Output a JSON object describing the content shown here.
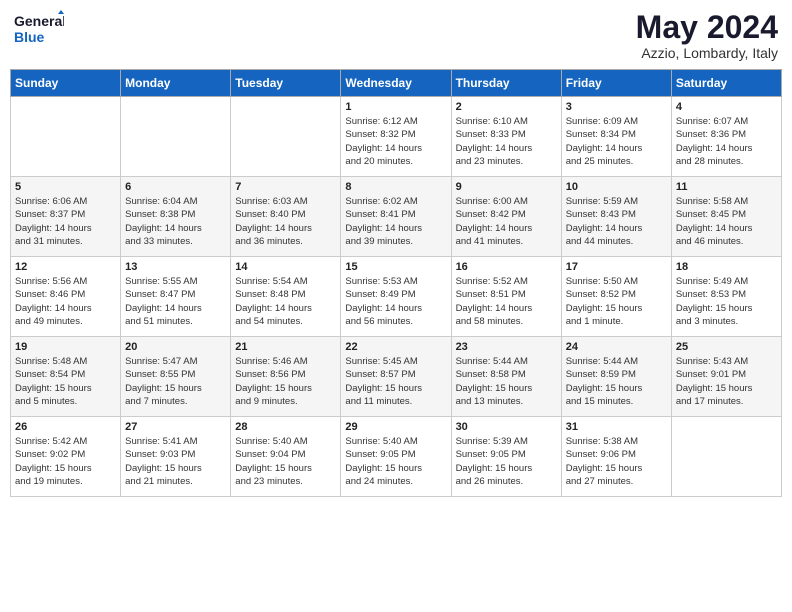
{
  "logo": {
    "line1": "General",
    "line2": "Blue"
  },
  "title": "May 2024",
  "location": "Azzio, Lombardy, Italy",
  "days_of_week": [
    "Sunday",
    "Monday",
    "Tuesday",
    "Wednesday",
    "Thursday",
    "Friday",
    "Saturday"
  ],
  "weeks": [
    [
      {
        "day": "",
        "info": ""
      },
      {
        "day": "",
        "info": ""
      },
      {
        "day": "",
        "info": ""
      },
      {
        "day": "1",
        "info": "Sunrise: 6:12 AM\nSunset: 8:32 PM\nDaylight: 14 hours\nand 20 minutes."
      },
      {
        "day": "2",
        "info": "Sunrise: 6:10 AM\nSunset: 8:33 PM\nDaylight: 14 hours\nand 23 minutes."
      },
      {
        "day": "3",
        "info": "Sunrise: 6:09 AM\nSunset: 8:34 PM\nDaylight: 14 hours\nand 25 minutes."
      },
      {
        "day": "4",
        "info": "Sunrise: 6:07 AM\nSunset: 8:36 PM\nDaylight: 14 hours\nand 28 minutes."
      }
    ],
    [
      {
        "day": "5",
        "info": "Sunrise: 6:06 AM\nSunset: 8:37 PM\nDaylight: 14 hours\nand 31 minutes."
      },
      {
        "day": "6",
        "info": "Sunrise: 6:04 AM\nSunset: 8:38 PM\nDaylight: 14 hours\nand 33 minutes."
      },
      {
        "day": "7",
        "info": "Sunrise: 6:03 AM\nSunset: 8:40 PM\nDaylight: 14 hours\nand 36 minutes."
      },
      {
        "day": "8",
        "info": "Sunrise: 6:02 AM\nSunset: 8:41 PM\nDaylight: 14 hours\nand 39 minutes."
      },
      {
        "day": "9",
        "info": "Sunrise: 6:00 AM\nSunset: 8:42 PM\nDaylight: 14 hours\nand 41 minutes."
      },
      {
        "day": "10",
        "info": "Sunrise: 5:59 AM\nSunset: 8:43 PM\nDaylight: 14 hours\nand 44 minutes."
      },
      {
        "day": "11",
        "info": "Sunrise: 5:58 AM\nSunset: 8:45 PM\nDaylight: 14 hours\nand 46 minutes."
      }
    ],
    [
      {
        "day": "12",
        "info": "Sunrise: 5:56 AM\nSunset: 8:46 PM\nDaylight: 14 hours\nand 49 minutes."
      },
      {
        "day": "13",
        "info": "Sunrise: 5:55 AM\nSunset: 8:47 PM\nDaylight: 14 hours\nand 51 minutes."
      },
      {
        "day": "14",
        "info": "Sunrise: 5:54 AM\nSunset: 8:48 PM\nDaylight: 14 hours\nand 54 minutes."
      },
      {
        "day": "15",
        "info": "Sunrise: 5:53 AM\nSunset: 8:49 PM\nDaylight: 14 hours\nand 56 minutes."
      },
      {
        "day": "16",
        "info": "Sunrise: 5:52 AM\nSunset: 8:51 PM\nDaylight: 14 hours\nand 58 minutes."
      },
      {
        "day": "17",
        "info": "Sunrise: 5:50 AM\nSunset: 8:52 PM\nDaylight: 15 hours\nand 1 minute."
      },
      {
        "day": "18",
        "info": "Sunrise: 5:49 AM\nSunset: 8:53 PM\nDaylight: 15 hours\nand 3 minutes."
      }
    ],
    [
      {
        "day": "19",
        "info": "Sunrise: 5:48 AM\nSunset: 8:54 PM\nDaylight: 15 hours\nand 5 minutes."
      },
      {
        "day": "20",
        "info": "Sunrise: 5:47 AM\nSunset: 8:55 PM\nDaylight: 15 hours\nand 7 minutes."
      },
      {
        "day": "21",
        "info": "Sunrise: 5:46 AM\nSunset: 8:56 PM\nDaylight: 15 hours\nand 9 minutes."
      },
      {
        "day": "22",
        "info": "Sunrise: 5:45 AM\nSunset: 8:57 PM\nDaylight: 15 hours\nand 11 minutes."
      },
      {
        "day": "23",
        "info": "Sunrise: 5:44 AM\nSunset: 8:58 PM\nDaylight: 15 hours\nand 13 minutes."
      },
      {
        "day": "24",
        "info": "Sunrise: 5:44 AM\nSunset: 8:59 PM\nDaylight: 15 hours\nand 15 minutes."
      },
      {
        "day": "25",
        "info": "Sunrise: 5:43 AM\nSunset: 9:01 PM\nDaylight: 15 hours\nand 17 minutes."
      }
    ],
    [
      {
        "day": "26",
        "info": "Sunrise: 5:42 AM\nSunset: 9:02 PM\nDaylight: 15 hours\nand 19 minutes."
      },
      {
        "day": "27",
        "info": "Sunrise: 5:41 AM\nSunset: 9:03 PM\nDaylight: 15 hours\nand 21 minutes."
      },
      {
        "day": "28",
        "info": "Sunrise: 5:40 AM\nSunset: 9:04 PM\nDaylight: 15 hours\nand 23 minutes."
      },
      {
        "day": "29",
        "info": "Sunrise: 5:40 AM\nSunset: 9:05 PM\nDaylight: 15 hours\nand 24 minutes."
      },
      {
        "day": "30",
        "info": "Sunrise: 5:39 AM\nSunset: 9:05 PM\nDaylight: 15 hours\nand 26 minutes."
      },
      {
        "day": "31",
        "info": "Sunrise: 5:38 AM\nSunset: 9:06 PM\nDaylight: 15 hours\nand 27 minutes."
      },
      {
        "day": "",
        "info": ""
      }
    ]
  ]
}
